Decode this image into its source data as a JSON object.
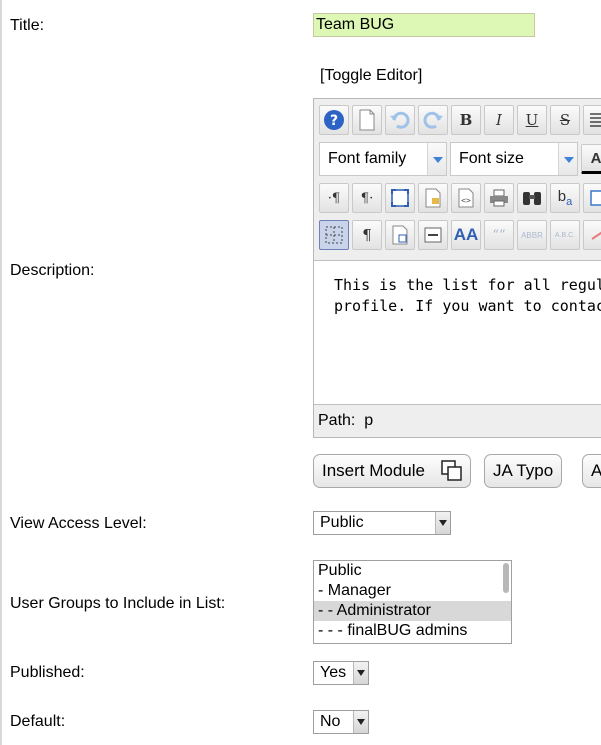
{
  "labels": {
    "title": "Title:",
    "description": "Description:",
    "view_access": "View Access Level:",
    "user_groups": "User Groups to Include in List:",
    "published": "Published:",
    "default": "Default:"
  },
  "title_value": "Team BUG",
  "toggle_editor": "[Toggle Editor]",
  "editor": {
    "font_family": "Font family",
    "font_size": "Font size",
    "content_line1": "This is the list for all regular blog",
    "content_line2": "profile. If you want to contact th",
    "path_label": "Path:",
    "path_value": "p"
  },
  "buttons": {
    "insert_module": "Insert Module",
    "ja_typo": "JA Typo",
    "third": "A"
  },
  "view_access_value": "Public",
  "user_groups": [
    {
      "label": "Public",
      "selected": false
    },
    {
      "label": "- Manager",
      "selected": false
    },
    {
      "label": "- - Administrator",
      "selected": true
    },
    {
      "label": "- - - finalBUG admins",
      "selected": false
    }
  ],
  "published_value": "Yes",
  "default_value": "No",
  "toolbar_text": {
    "bold": "B",
    "italic": "I",
    "underline": "U",
    "strike": "S",
    "ltr": "·¶",
    "rtl": "¶·",
    "pilcrow": "¶",
    "case": "b",
    "case_sub": "a",
    "styles": "AA",
    "cite": "“”",
    "abbr": "ABBR",
    "acronym": "A.B.C."
  }
}
